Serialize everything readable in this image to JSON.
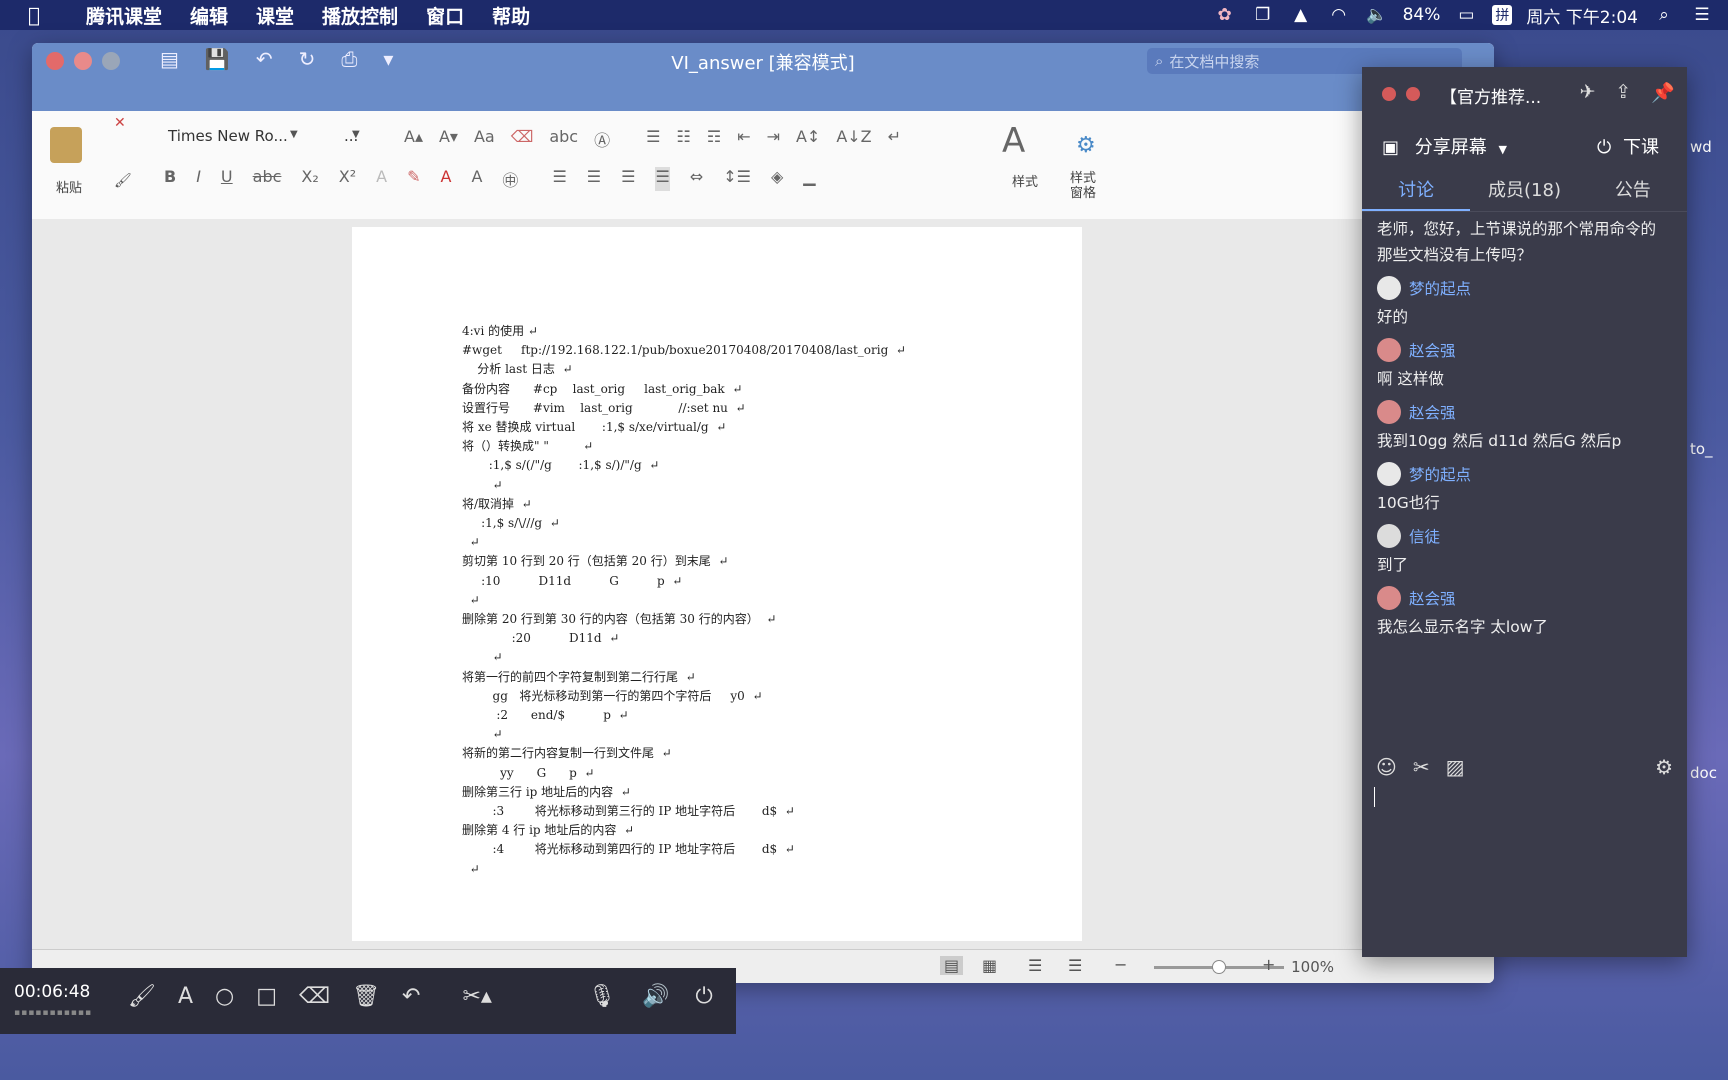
{
  "menubar": {
    "apple_icon": "apple-logo",
    "items": [
      "腾讯课堂",
      "编辑",
      "课堂",
      "播放控制",
      "窗口",
      "帮助"
    ],
    "battery": "84%",
    "input_method": "拼",
    "clock": "周六 下午2:04"
  },
  "word": {
    "title": "VI_answer [兼容模式]",
    "search_placeholder": "在文档中搜索",
    "ribbon": {
      "paste": "粘贴",
      "font_name": "Times New Ro...",
      "font_size": "...",
      "styles": "样式",
      "styles_pane": "样式\n窗格"
    },
    "document": {
      "lines": [
        "4:vi 的使用 ↵",
        "#wget     ftp://192.168.122.1/pub/boxue20170408/20170408/last_orig  ↵",
        "    分析 last 日志  ↵",
        "备份内容      #cp    last_orig     last_orig_bak  ↵",
        "设置行号      #vim    last_orig            //:set nu  ↵",
        "将 xe 替换成 virtual       :1,$ s/xe/virtual/g  ↵",
        "将（）转换成\" \"         ↵",
        "       :1,$ s/(/\"/g       :1,$ s/)/\"/g  ↵",
        "        ↵",
        "将/取消掉  ↵",
        "     :1,$ s/\\///g  ↵",
        "  ↵",
        "剪切第 10 行到 20 行（包括第 20 行）到末尾  ↵",
        "     :10          D11d          G          p  ↵",
        "  ↵",
        "删除第 20 行到第 30 行的内容（包括第 30 行的内容）  ↵",
        "             :20          D11d  ↵",
        "        ↵",
        "将第一行的前四个字符复制到第二行行尾  ↵",
        "        gg   将光标移动到第一行的第四个字符后     y0  ↵",
        "         :2      end/$          p  ↵",
        "        ↵",
        "将新的第二行内容复制一行到文件尾  ↵",
        "          yy      G      p  ↵",
        "删除第三行 ip 地址后的内容  ↵",
        "        :3        将光标移动到第三行的 IP 地址字符后       d$  ↵",
        "删除第 4 行 ip 地址后的内容  ↵",
        "        :4        将光标移动到第四行的 IP 地址字符后       d$  ↵",
        "  ↵"
      ]
    },
    "zoom": "100%"
  },
  "chat": {
    "title": "【官方推荐...",
    "share_screen": "分享屏幕",
    "end_class": "下课",
    "tabs": [
      "讨论",
      "成员(18)",
      "公告"
    ],
    "messages": [
      {
        "sender": "",
        "text": "老师，您好，上节课说的那个常用命令的那些文档没有上传吗？",
        "avatar": ""
      },
      {
        "sender": "梦的起点",
        "text": "好的",
        "avatar": "#e8e8e8"
      },
      {
        "sender": "赵会强",
        "text": "啊 这样做",
        "avatar": "#d98a8a"
      },
      {
        "sender": "赵会强",
        "text": "我到10gg 然后 d11d 然后G 然后p",
        "avatar": "#d98a8a"
      },
      {
        "sender": "梦的起点",
        "text": "10G也行",
        "avatar": "#e8e8e8"
      },
      {
        "sender": "信徒",
        "text": "到了",
        "avatar": "#dcdcdc"
      },
      {
        "sender": "赵会强",
        "text": "我怎么显示名字 太low了",
        "avatar": "#d98a8a"
      }
    ]
  },
  "recorder": {
    "time": "00:06:48"
  },
  "bg": {
    "wd": "wd",
    "to": "to_",
    "doc": "doc"
  }
}
